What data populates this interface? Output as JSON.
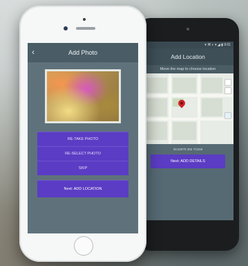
{
  "android": {
    "status": "▾ ⌘ ◐ ▾ ◢ ▮ 9:01",
    "title": "Add Location",
    "hint": "Move the map to choose location",
    "coords": "38.62878 356 7/4266",
    "next_label": "Next: ADD DETAILS"
  },
  "iphone": {
    "title": "Add Photo",
    "back_icon": "‹",
    "buttons": {
      "retake": "RE-TAKE PHOTO",
      "reselect": "RE-SELECT PHOTO",
      "skip": "SKIP",
      "next": "Next: ADD LOCATION"
    }
  },
  "colors": {
    "accent": "#5b3cc4",
    "appbar": "#4a5d66",
    "screen_bg": "#5f727b",
    "map_pin": "#d0232b"
  },
  "icons": {
    "back": "chevron-left-icon",
    "pin": "map-pin-icon",
    "home": "home-button-icon"
  }
}
